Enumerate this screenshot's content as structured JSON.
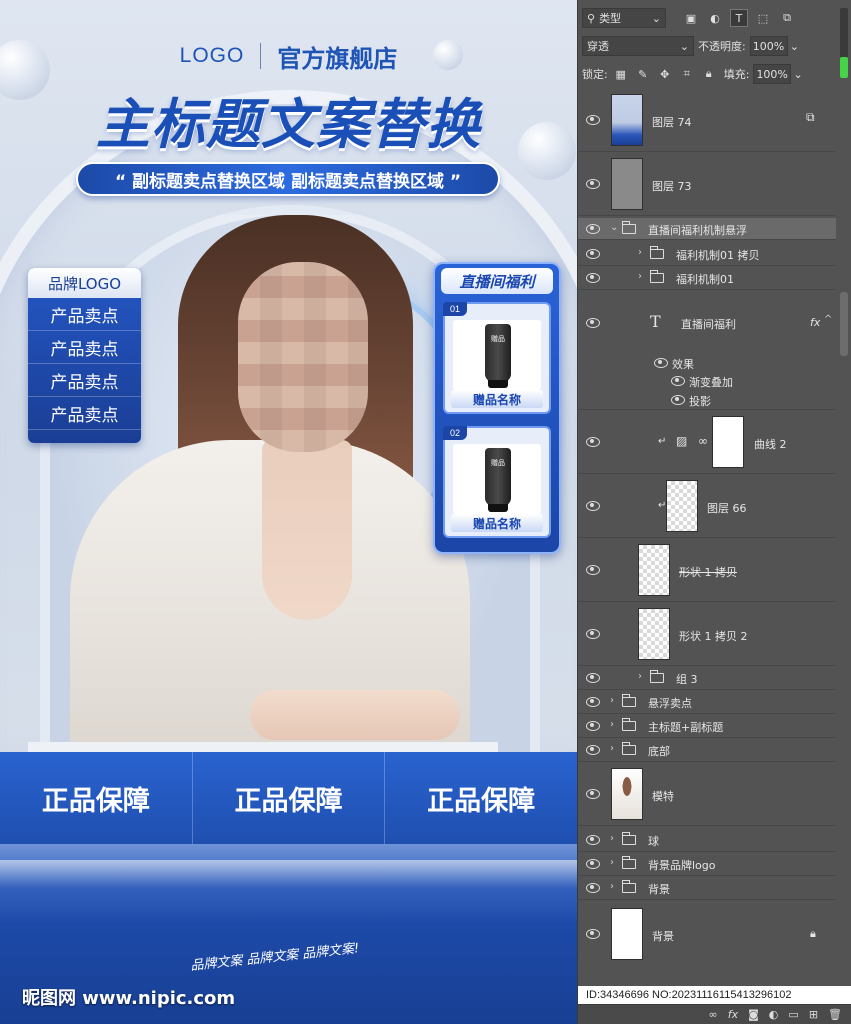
{
  "poster": {
    "logo": "LOGO",
    "store_name": "官方旗舰店",
    "main_title": "主标题文案替换",
    "subtitle": "“ 副标题卖点替换区域  副标题卖点替换区域 ”",
    "side_panel": {
      "header": "品牌LOGO",
      "items": [
        "产品卖点",
        "产品卖点",
        "产品卖点",
        "产品卖点"
      ]
    },
    "welfare": {
      "title": "直播间福利",
      "gifts": [
        {
          "num": "01",
          "tag": "赠品",
          "name": "赠品名称"
        },
        {
          "num": "02",
          "tag": "赠品",
          "name": "赠品名称"
        }
      ]
    },
    "guarantees": [
      "正品保障",
      "正品保障",
      "正品保障"
    ],
    "brand_copy": "品牌文案  品牌文案  品牌文案!",
    "watermark": "昵图网 www.nipic.com"
  },
  "layers_panel": {
    "filter_kind": "类型",
    "blend_mode": "穿透",
    "opacity_label": "不透明度:",
    "opacity_value": "100%",
    "lock_label": "锁定:",
    "fill_label": "填充:",
    "fill_value": "100%",
    "layers": [
      {
        "name": "图层 74",
        "kind": "smart"
      },
      {
        "name": "图层 73",
        "kind": "pixel"
      },
      {
        "name": "直播间福利机制悬浮",
        "kind": "group-open"
      },
      {
        "name": "福利机制01 拷贝",
        "kind": "group"
      },
      {
        "name": "福利机制01",
        "kind": "group"
      },
      {
        "name": "直播间福利",
        "kind": "text"
      },
      {
        "name": "效果",
        "kind": "effects"
      },
      {
        "name": "渐变叠加",
        "kind": "effect"
      },
      {
        "name": "投影",
        "kind": "effect"
      },
      {
        "name": "曲线 2",
        "kind": "adjust"
      },
      {
        "name": "图层 66",
        "kind": "pixel-clip"
      },
      {
        "name": "形状 1 拷贝",
        "kind": "shape"
      },
      {
        "name": "形状 1 拷贝 2",
        "kind": "shape"
      },
      {
        "name": "组 3",
        "kind": "group"
      },
      {
        "name": "悬浮卖点",
        "kind": "group"
      },
      {
        "name": "主标题+副标题",
        "kind": "group"
      },
      {
        "name": "底部",
        "kind": "group"
      },
      {
        "name": "模特",
        "kind": "pixel"
      },
      {
        "name": "球",
        "kind": "group"
      },
      {
        "name": "背景品牌logo",
        "kind": "group"
      },
      {
        "name": "背景",
        "kind": "group"
      },
      {
        "name": "背景",
        "kind": "background"
      }
    ],
    "id_text": "ID:34346696 NO:20231116115413296102",
    "fill_level": 0.3
  }
}
